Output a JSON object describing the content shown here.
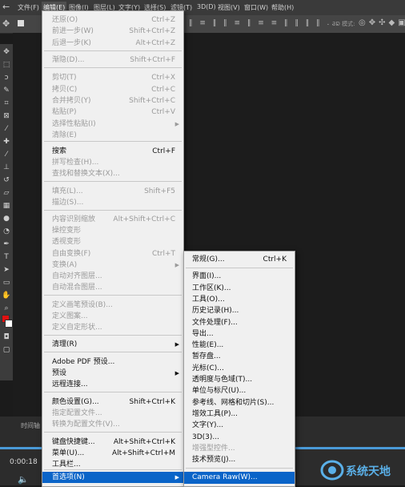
{
  "menubar": {
    "items": [
      "文件(F)",
      "编辑(E)",
      "图像(I)",
      "图层(L)",
      "文字(Y)",
      "选择(S)",
      "滤镜(T)",
      "3D(D)",
      "视图(V)",
      "窗口(W)",
      "帮助(H)"
    ]
  },
  "optionsbar": {
    "mode_label": "3D 模式:"
  },
  "edit_menu": {
    "items": [
      {
        "label": "还原(O)",
        "shortcut": "Ctrl+Z",
        "disabled": true
      },
      {
        "label": "前进一步(W)",
        "shortcut": "Shift+Ctrl+Z",
        "disabled": true
      },
      {
        "label": "后退一步(K)",
        "shortcut": "Alt+Ctrl+Z",
        "disabled": true
      },
      {
        "label": "渐隐(D)...",
        "shortcut": "Shift+Ctrl+F",
        "disabled": true
      },
      {
        "label": "剪切(T)",
        "shortcut": "Ctrl+X",
        "disabled": true
      },
      {
        "label": "拷贝(C)",
        "shortcut": "Ctrl+C",
        "disabled": true
      },
      {
        "label": "合并拷贝(Y)",
        "shortcut": "Shift+Ctrl+C",
        "disabled": true
      },
      {
        "label": "粘贴(P)",
        "shortcut": "Ctrl+V",
        "disabled": true
      },
      {
        "label": "选择性粘贴(I)",
        "shortcut": "",
        "disabled": true,
        "submenu": true
      },
      {
        "label": "清除(E)",
        "shortcut": "",
        "disabled": true
      },
      {
        "label": "搜索",
        "shortcut": "Ctrl+F",
        "disabled": false
      },
      {
        "label": "拼写检查(H)...",
        "shortcut": "",
        "disabled": true
      },
      {
        "label": "查找和替换文本(X)...",
        "shortcut": "",
        "disabled": true
      },
      {
        "label": "填充(L)...",
        "shortcut": "Shift+F5",
        "disabled": true
      },
      {
        "label": "描边(S)...",
        "shortcut": "",
        "disabled": true
      },
      {
        "label": "内容识别缩放",
        "shortcut": "Alt+Shift+Ctrl+C",
        "disabled": true
      },
      {
        "label": "操控变形",
        "shortcut": "",
        "disabled": true
      },
      {
        "label": "透视变形",
        "shortcut": "",
        "disabled": true
      },
      {
        "label": "自由变换(F)",
        "shortcut": "Ctrl+T",
        "disabled": true
      },
      {
        "label": "变换(A)",
        "shortcut": "",
        "disabled": true,
        "submenu": true
      },
      {
        "label": "自动对齐图层...",
        "shortcut": "",
        "disabled": true
      },
      {
        "label": "自动混合图层...",
        "shortcut": "",
        "disabled": true
      },
      {
        "label": "定义画笔预设(B)...",
        "shortcut": "",
        "disabled": true
      },
      {
        "label": "定义图案...",
        "shortcut": "",
        "disabled": true
      },
      {
        "label": "定义自定形状...",
        "shortcut": "",
        "disabled": true
      },
      {
        "label": "清理(R)",
        "shortcut": "",
        "disabled": false,
        "submenu": true
      },
      {
        "label": "Adobe PDF 预设...",
        "shortcut": "",
        "disabled": false
      },
      {
        "label": "预设",
        "shortcut": "",
        "disabled": false,
        "submenu": true
      },
      {
        "label": "远程连接...",
        "shortcut": "",
        "disabled": false
      },
      {
        "label": "颜色设置(G)...",
        "shortcut": "Shift+Ctrl+K",
        "disabled": false
      },
      {
        "label": "指定配置文件...",
        "shortcut": "",
        "disabled": true
      },
      {
        "label": "转换为配置文件(V)...",
        "shortcut": "",
        "disabled": true
      },
      {
        "label": "键盘快捷键...",
        "shortcut": "Alt+Shift+Ctrl+K",
        "disabled": false
      },
      {
        "label": "菜单(U)...",
        "shortcut": "Alt+Shift+Ctrl+M",
        "disabled": false
      },
      {
        "label": "工具栏...",
        "shortcut": "",
        "disabled": false
      },
      {
        "label": "首选项(N)",
        "shortcut": "",
        "disabled": false,
        "submenu": true,
        "highlighted": true
      }
    ]
  },
  "preferences_submenu": {
    "items": [
      {
        "label": "常规(G)...",
        "shortcut": "Ctrl+K",
        "disabled": false
      },
      {
        "label": "界面(I)...",
        "shortcut": "",
        "disabled": false
      },
      {
        "label": "工作区(K)...",
        "shortcut": "",
        "disabled": false
      },
      {
        "label": "工具(O)...",
        "shortcut": "",
        "disabled": false
      },
      {
        "label": "历史记录(H)...",
        "shortcut": "",
        "disabled": false
      },
      {
        "label": "文件处理(F)...",
        "shortcut": "",
        "disabled": false
      },
      {
        "label": "导出...",
        "shortcut": "",
        "disabled": false
      },
      {
        "label": "性能(E)...",
        "shortcut": "",
        "disabled": false
      },
      {
        "label": "暂存盘...",
        "shortcut": "",
        "disabled": false
      },
      {
        "label": "光标(C)...",
        "shortcut": "",
        "disabled": false
      },
      {
        "label": "透明度与色域(T)...",
        "shortcut": "",
        "disabled": false
      },
      {
        "label": "单位与标尺(U)...",
        "shortcut": "",
        "disabled": false
      },
      {
        "label": "参考线、网格和切片(S)...",
        "shortcut": "",
        "disabled": false
      },
      {
        "label": "增效工具(P)...",
        "shortcut": "",
        "disabled": false
      },
      {
        "label": "文字(Y)...",
        "shortcut": "",
        "disabled": false
      },
      {
        "label": "3D(3)...",
        "shortcut": "",
        "disabled": false
      },
      {
        "label": "增强型控件...",
        "shortcut": "",
        "disabled": true
      },
      {
        "label": "技术预览(J)...",
        "shortcut": "",
        "disabled": false
      },
      {
        "label": "Camera Raw(W)...",
        "shortcut": "",
        "disabled": true,
        "highlighted": true
      }
    ]
  },
  "timeline": {
    "tab_label": "时间轴",
    "time": "0:00:18"
  },
  "watermark": {
    "text": "系统天地"
  },
  "colors": {
    "menu_bg": "#f0f0f0",
    "highlight": "#0a64c8",
    "foreground_swatch": "#e01010",
    "background_swatch": "#ffffff"
  }
}
